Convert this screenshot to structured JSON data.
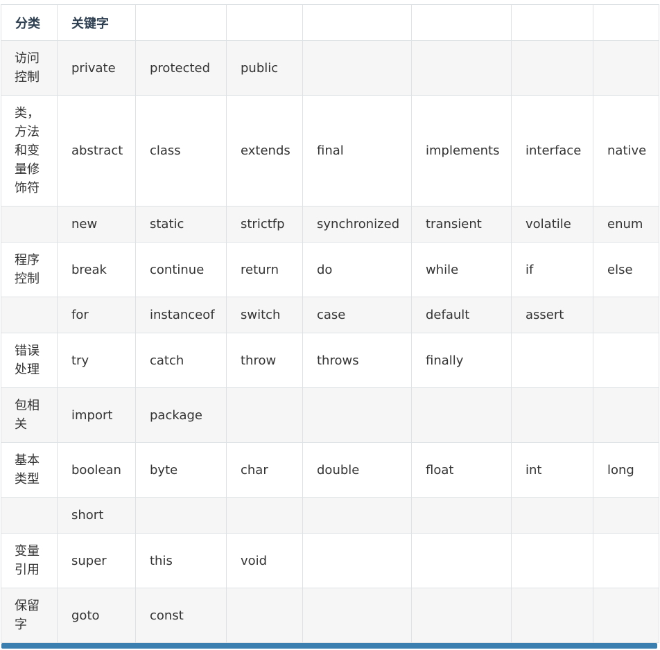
{
  "table": {
    "headers": [
      "分类",
      "关键字",
      "",
      "",
      "",
      "",
      "",
      ""
    ],
    "rows": [
      [
        "访问控制",
        "private",
        "protected",
        "public",
        "",
        "",
        "",
        ""
      ],
      [
        "类，方法和变量修饰符",
        "abstract",
        "class",
        "extends",
        "final",
        "implements",
        "interface",
        "native"
      ],
      [
        "",
        "new",
        "static",
        "strictfp",
        "synchronized",
        "transient",
        "volatile",
        "enum"
      ],
      [
        "程序控制",
        "break",
        "continue",
        "return",
        "do",
        "while",
        "if",
        "else"
      ],
      [
        "",
        "for",
        "instanceof",
        "switch",
        "case",
        "default",
        "assert",
        ""
      ],
      [
        "错误处理",
        "try",
        "catch",
        "throw",
        "throws",
        "finally",
        "",
        ""
      ],
      [
        "包相关",
        "import",
        "package",
        "",
        "",
        "",
        "",
        ""
      ],
      [
        "基本类型",
        "boolean",
        "byte",
        "char",
        "double",
        "float",
        "int",
        "long"
      ],
      [
        "",
        "short",
        "",
        "",
        "",
        "",
        "",
        ""
      ],
      [
        "变量引用",
        "super",
        "this",
        "void",
        "",
        "",
        "",
        ""
      ],
      [
        "保留字",
        "goto",
        "const",
        "",
        "",
        "",
        "",
        ""
      ]
    ]
  },
  "colors": {
    "border": "#dfe2e5",
    "row_alt_bg": "#f6f6f6",
    "scrollbar": "#3b7fb0"
  }
}
